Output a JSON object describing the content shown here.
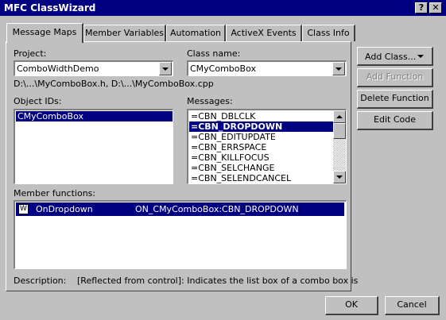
{
  "window": {
    "title": "MFC ClassWizard",
    "help_glyph": "?",
    "close_glyph": "✕"
  },
  "tabs": [
    {
      "label": "Message Maps"
    },
    {
      "label": "Member Variables"
    },
    {
      "label": "Automation"
    },
    {
      "label": "ActiveX Events"
    },
    {
      "label": "Class Info"
    }
  ],
  "project": {
    "label": "Project:",
    "value": "ComboWidthDemo"
  },
  "class_name": {
    "label": "Class name:",
    "value": "CMyComboBox"
  },
  "file_paths": "D:\\...\\MyComboBox.h, D:\\...\\MyComboBox.cpp",
  "object_ids": {
    "label": "Object IDs:",
    "items": [
      "CMyComboBox"
    ]
  },
  "messages": {
    "label": "Messages:",
    "items": [
      "=CBN_DBLCLK",
      "=CBN_DROPDOWN",
      "=CBN_EDITUPDATE",
      "=CBN_ERRSPACE",
      "=CBN_KILLFOCUS",
      "=CBN_SELCHANGE",
      "=CBN_SELENDCANCEL"
    ]
  },
  "member_functions": {
    "label": "Member functions:",
    "rows": [
      {
        "badge": "W",
        "name": "OnDropdown",
        "handler": "ON_CMyComboBox:CBN_DROPDOWN"
      }
    ]
  },
  "description": {
    "label": "Description:",
    "text": "[Reflected from control]: Indicates the list box of a combo box is"
  },
  "buttons": {
    "add_class": "Add Class...",
    "add_function": "Add Function",
    "delete_function": "Delete Function",
    "edit_code": "Edit Code",
    "ok": "OK",
    "cancel": "Cancel"
  },
  "colors": {
    "title_bar": "#000080",
    "selection": "#000080",
    "face": "#c0c0c0"
  },
  "icons": {
    "dropdown": "chevron-down-icon",
    "scroll_up": "arrow-up-icon",
    "scroll_down": "arrow-down-icon"
  }
}
